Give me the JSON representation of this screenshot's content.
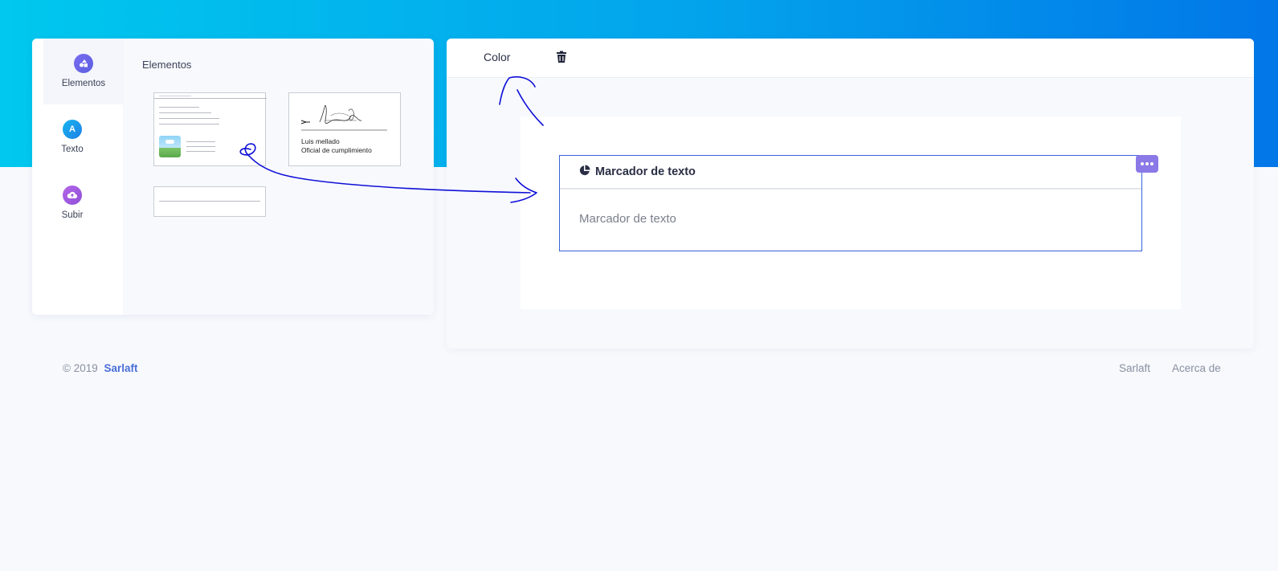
{
  "sidebar": {
    "items": [
      {
        "label": "Elementos",
        "icon": "shapes-icon"
      },
      {
        "label": "Texto",
        "icon": "text-a-icon",
        "glyph": "A"
      },
      {
        "label": "Subir",
        "icon": "cloud-upload-icon"
      }
    ]
  },
  "elements_panel": {
    "title": "Elementos",
    "signature_template": {
      "name": "Luis mellado",
      "role": "Oficial de cumplimiento"
    }
  },
  "toolbar": {
    "color_label": "Color"
  },
  "canvas": {
    "field": {
      "title": "Marcador de texto",
      "placeholder": "Marcador de texto"
    }
  },
  "footer": {
    "copyright": "© 2019",
    "brand": "Sarlaft",
    "links": [
      "Sarlaft",
      "Acerca de"
    ]
  },
  "colors": {
    "accent": "#3a62d7",
    "more_button": "#8a79e6",
    "annotation_ink": "#1010d8",
    "header_gradient_start": "#00c8ee",
    "header_gradient_end": "#0277e8"
  }
}
